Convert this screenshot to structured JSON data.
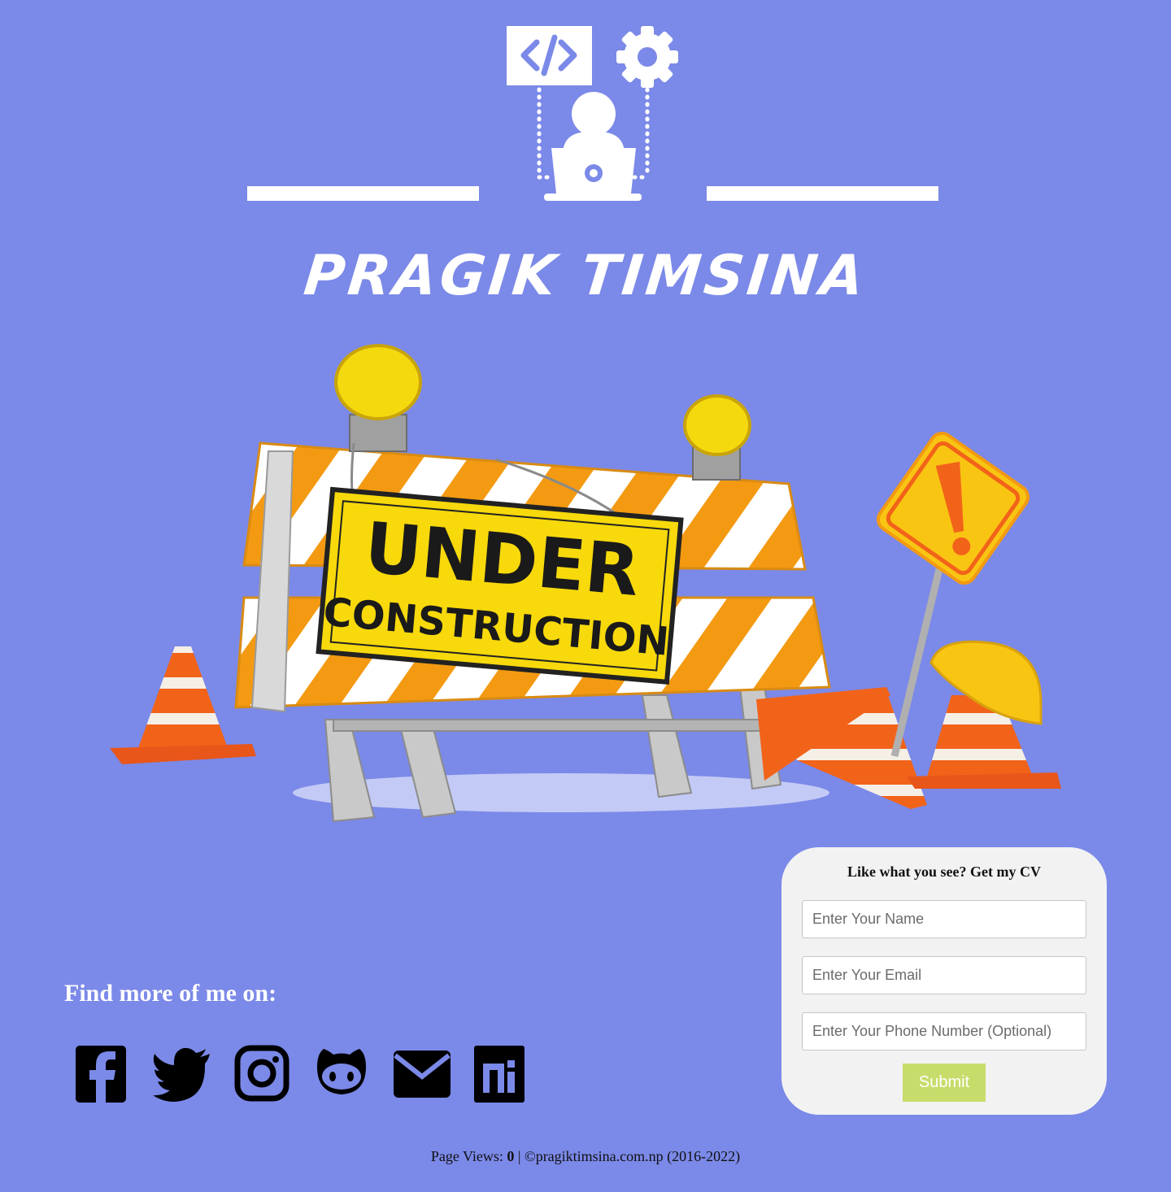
{
  "header": {
    "site_title": "PRAGIK TIMSINA",
    "logo_icons": [
      "code-icon",
      "gear-icon",
      "developer-laptop-icon"
    ]
  },
  "hero": {
    "sign_line1": "UNDER",
    "sign_line2": "CONSTRUCTION"
  },
  "social": {
    "title": "Find more of me on:",
    "links": [
      {
        "icon": "facebook-icon"
      },
      {
        "icon": "twitter-icon"
      },
      {
        "icon": "instagram-icon"
      },
      {
        "icon": "github-icon"
      },
      {
        "icon": "email-icon"
      },
      {
        "icon": "npm-icon"
      }
    ]
  },
  "cv_form": {
    "title": "Like what you see? Get my CV",
    "name_placeholder": "Enter Your Name",
    "email_placeholder": "Enter Your Email",
    "phone_placeholder": "Enter Your Phone Number (Optional)",
    "submit_label": "Submit"
  },
  "footer": {
    "views_label": "Page Views:",
    "views_count": "0",
    "separator": "|",
    "copyright": "©pragiktimsina.com.np (2016-2022)"
  },
  "colors": {
    "background": "#7b89e8",
    "card": "#f2f2f2",
    "submit": "#c6dd6b",
    "sign_yellow": "#f7d90c",
    "stripe_orange": "#f39a12"
  }
}
